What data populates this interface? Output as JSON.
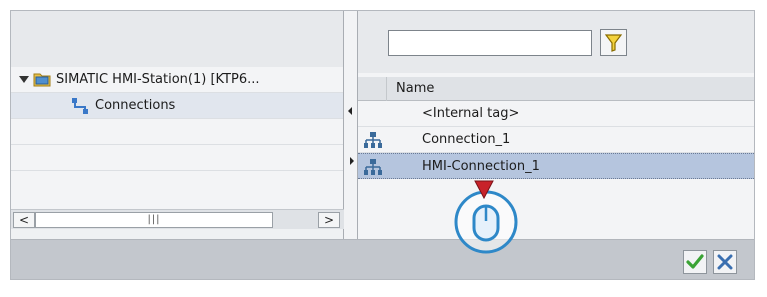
{
  "tree": {
    "station": "SIMATIC HMI-Station(1) [KTP6...",
    "connections": "Connections"
  },
  "scrollbar": {
    "left_arrow": "<",
    "right_arrow": ">",
    "thumb_grip": "|||"
  },
  "search": {
    "value": "",
    "placeholder": ""
  },
  "table": {
    "column_header": "Name",
    "rows": [
      {
        "label": "<Internal tag>"
      },
      {
        "label": "Connection_1"
      },
      {
        "label": "HMI-Connection_1"
      }
    ]
  },
  "colors": {
    "selection": "#b5c5de",
    "ok_check": "#3aa335",
    "cancel_x": "#3a6fb0",
    "cursor_ring": "#2e88c8",
    "cursor_pointer": "#c8222a"
  },
  "icons": {
    "expand": "tree-expand-arrow-icon",
    "folder": "hmi-station-folder-icon",
    "connections": "connections-icon",
    "network": "network-connection-icon",
    "filter": "filter-funnel-icon",
    "ok": "checkmark-icon",
    "cancel": "close-x-icon",
    "cursor": "mouse-click-cursor-icon"
  }
}
